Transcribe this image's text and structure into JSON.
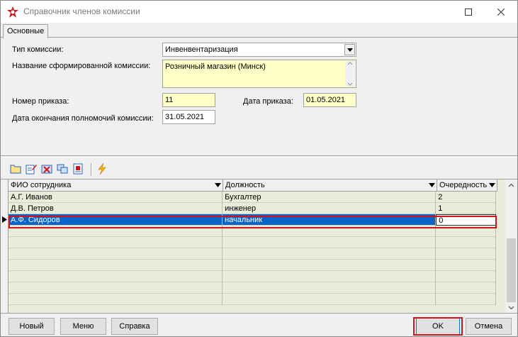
{
  "window": {
    "title": "Справочник членов комиссии"
  },
  "tabs": [
    {
      "label": "Основные",
      "active": true
    }
  ],
  "form": {
    "commission_type_label": "Тип комиссии:",
    "commission_type_value": "Инвенвентаризация",
    "commission_name_label": "Название сформированной комиссии:",
    "commission_name_value": "Розничный магазин (Минск)",
    "order_number_label": "Номер приказа:",
    "order_number_value": "11",
    "order_date_label": "Дата приказа:",
    "order_date_value": "01.05.2021",
    "end_date_label": "Дата окончания полномочий комиссии:",
    "end_date_value": "31.05.2021"
  },
  "toolbar": {
    "icons": [
      "open-folder-icon",
      "edit-icon",
      "delete-icon",
      "copy-icon",
      "properties-icon",
      "lightning-icon"
    ]
  },
  "grid": {
    "columns": [
      "ФИО сотрудника",
      "Должность",
      "Очередность"
    ],
    "rows": [
      {
        "name": "А.Г. Иванов",
        "position": "Бухгалтер",
        "order": "2"
      },
      {
        "name": "Д.В. Петров",
        "position": "инженер",
        "order": "1"
      },
      {
        "name": "А.Ф. Сидоров",
        "position": "начальник",
        "order": "0"
      }
    ],
    "selected_row": 2
  },
  "buttons": {
    "new": "Новый",
    "menu": "Меню",
    "help": "Справка",
    "ok": "OK",
    "cancel": "Отмена"
  },
  "colors": {
    "field_yellow": "#ffffc8",
    "grid_bg": "#e9ecd9",
    "selection": "#0a64c8",
    "highlight": "#d0141e"
  }
}
